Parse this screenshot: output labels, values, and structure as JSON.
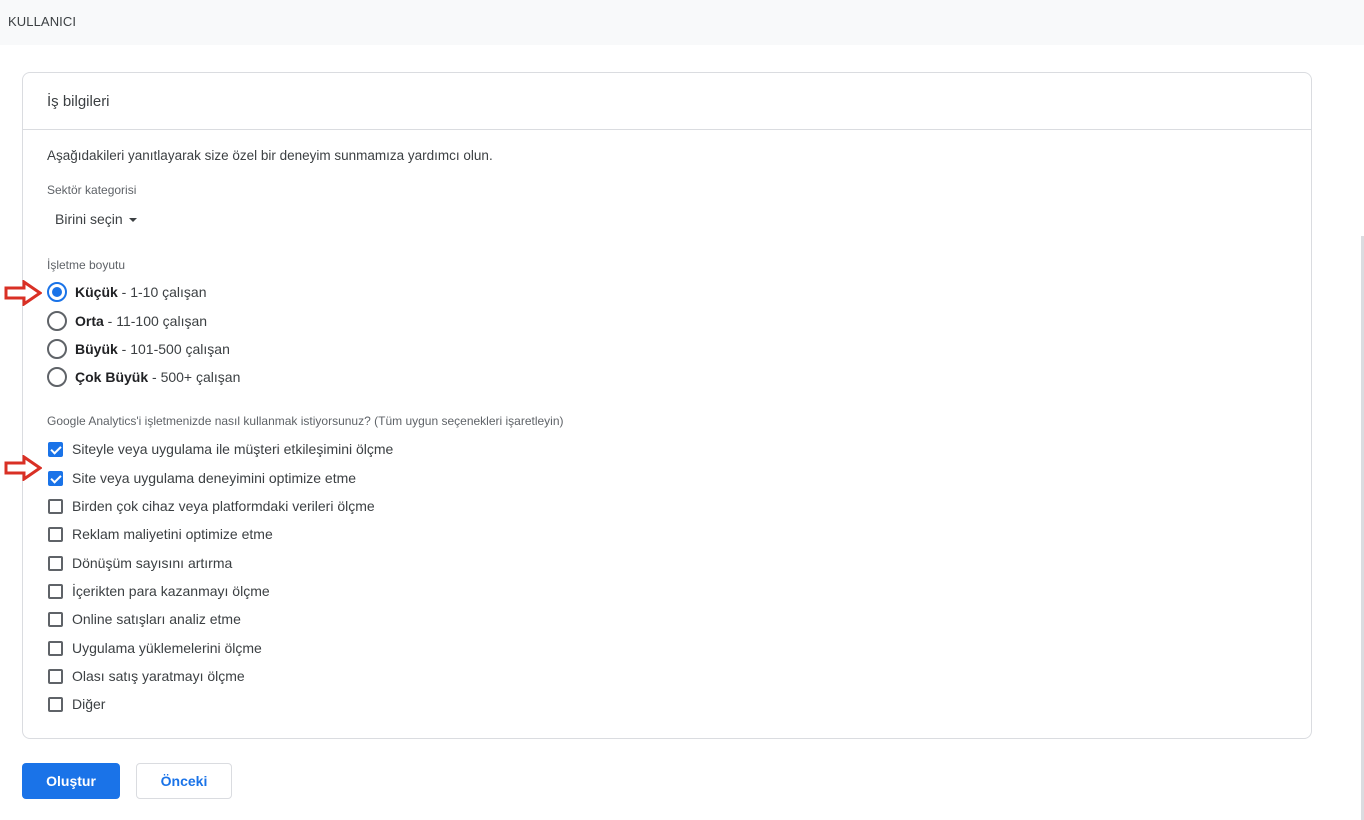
{
  "topbar": {
    "title": "KULLANICI"
  },
  "card": {
    "title": "İş bilgileri",
    "intro": "Aşağıdakileri yanıtlayarak size özel bir deneyim sunmamıza yardımcı olun.",
    "sector": {
      "label": "Sektör kategorisi",
      "value": "Birini seçin"
    },
    "size": {
      "label": "İşletme boyutu",
      "options": [
        {
          "name": "Küçük",
          "detail": " - 1-10 çalışan",
          "selected": true
        },
        {
          "name": "Orta",
          "detail": " - 11-100 çalışan",
          "selected": false
        },
        {
          "name": "Büyük",
          "detail": " - 101-500 çalışan",
          "selected": false
        },
        {
          "name": "Çok Büyük",
          "detail": " - 500+ çalışan",
          "selected": false
        }
      ]
    },
    "usage": {
      "label": "Google Analytics'i işletmenizde nasıl kullanmak istiyorsunuz? (Tüm uygun seçenekleri işaretleyin)",
      "options": [
        {
          "label": "Siteyle veya uygulama ile müşteri etkileşimini ölçme",
          "checked": true
        },
        {
          "label": "Site veya uygulama deneyimini optimize etme",
          "checked": true
        },
        {
          "label": "Birden çok cihaz veya platformdaki verileri ölçme",
          "checked": false
        },
        {
          "label": "Reklam maliyetini optimize etme",
          "checked": false
        },
        {
          "label": "Dönüşüm sayısını artırma",
          "checked": false
        },
        {
          "label": "İçerikten para kazanmayı ölçme",
          "checked": false
        },
        {
          "label": "Online satışları analiz etme",
          "checked": false
        },
        {
          "label": "Uygulama yüklemelerini ölçme",
          "checked": false
        },
        {
          "label": "Olası satış yaratmayı ölçme",
          "checked": false
        },
        {
          "label": "Diğer",
          "checked": false
        }
      ]
    }
  },
  "buttons": {
    "create": "Oluştur",
    "previous": "Önceki"
  },
  "colors": {
    "accent": "#1a73e8",
    "annotation_arrow": "#d93025"
  }
}
